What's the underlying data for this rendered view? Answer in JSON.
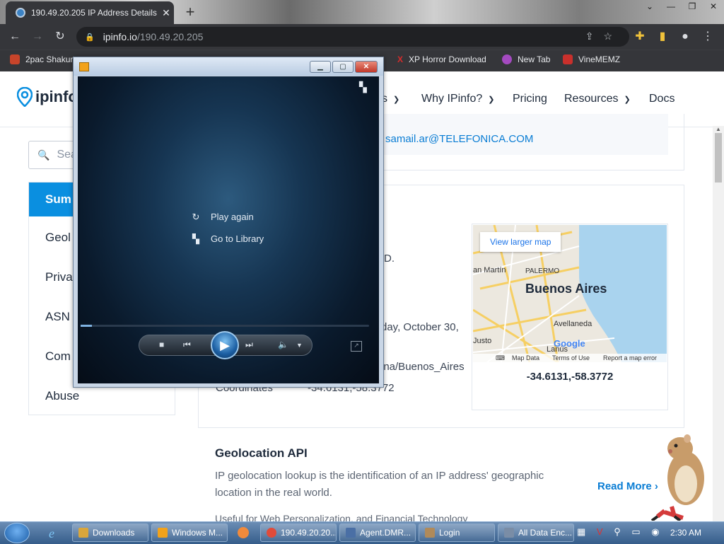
{
  "browser": {
    "tab_title": "190.49.20.205 IP Address Details",
    "url_host": "ipinfo.io",
    "url_path": "/190.49.20.205",
    "bookmarks": [
      {
        "label": "2pac Shakur",
        "color": "#c7442a"
      },
      {
        "label": "XP Horror Download",
        "color": "#d62b2b"
      },
      {
        "label": "New Tab",
        "color": "#a44ac0"
      },
      {
        "label": "VineMEMZ",
        "color": "#c9302c"
      }
    ]
  },
  "site": {
    "logo": "ipinfo",
    "nav": [
      {
        "label": "s",
        "has_menu": true
      },
      {
        "label": "Why IPinfo?",
        "has_menu": true
      },
      {
        "label": "Pricing",
        "has_menu": false
      },
      {
        "label": "Resources",
        "has_menu": true
      },
      {
        "label": "Docs",
        "has_menu": false
      }
    ],
    "search_placeholder": "Sea",
    "sidebar": [
      {
        "label": "Sum",
        "active": true
      },
      {
        "label": "Geol",
        "active": false
      },
      {
        "label": "Priva",
        "active": false
      },
      {
        "label": "ASN",
        "active": false
      },
      {
        "label": "Com",
        "active": false
      },
      {
        "label": "Abuse",
        "active": false
      }
    ],
    "email_fragment": "samail.ar@TELEFONICA.COM",
    "geo_fragments": {
      "d": "D.",
      "date": "day, October 30,",
      "tz": "ina/Buenos_Aires",
      "coord_label": "Coordinates",
      "coord_value": "-34.6131,-58.3772"
    },
    "map": {
      "button": "View larger map",
      "city": "Buenos Aires",
      "labels": [
        "an Martín",
        "PALERMO",
        "Avellaneda",
        "Justo",
        "Lanús"
      ],
      "google": "Google",
      "footer": [
        "Map Data",
        "Terms of Use",
        "Report a map error"
      ],
      "caption": "-34.6131,-58.3772"
    },
    "geo_api": {
      "heading": "Geolocation API",
      "description": "IP geolocation lookup is the identification of an IP address' geographic location in the real world.",
      "subtext": "Useful for Web Personalization, and Financial Technology",
      "read_more": "Read More"
    }
  },
  "media_player": {
    "menu": [
      {
        "label": "Play again",
        "icon": "replay-icon"
      },
      {
        "label": "Go to Library",
        "icon": "library-icon"
      }
    ],
    "progress": 0.04
  },
  "taskbar": {
    "items": [
      {
        "label": "Downloads",
        "color": "#d9a63c"
      },
      {
        "label": "Windows M...",
        "color": "#f2a21b"
      },
      {
        "label": "190.49.20.20...",
        "color": "#e04b3a"
      },
      {
        "label": "Agent.DMR...",
        "color": "#4a6fa5"
      },
      {
        "label": "Login",
        "color": "#b08a5a"
      },
      {
        "label": "All Data Enc...",
        "color": "#7a8da6"
      }
    ],
    "clock": "2:30 AM"
  }
}
